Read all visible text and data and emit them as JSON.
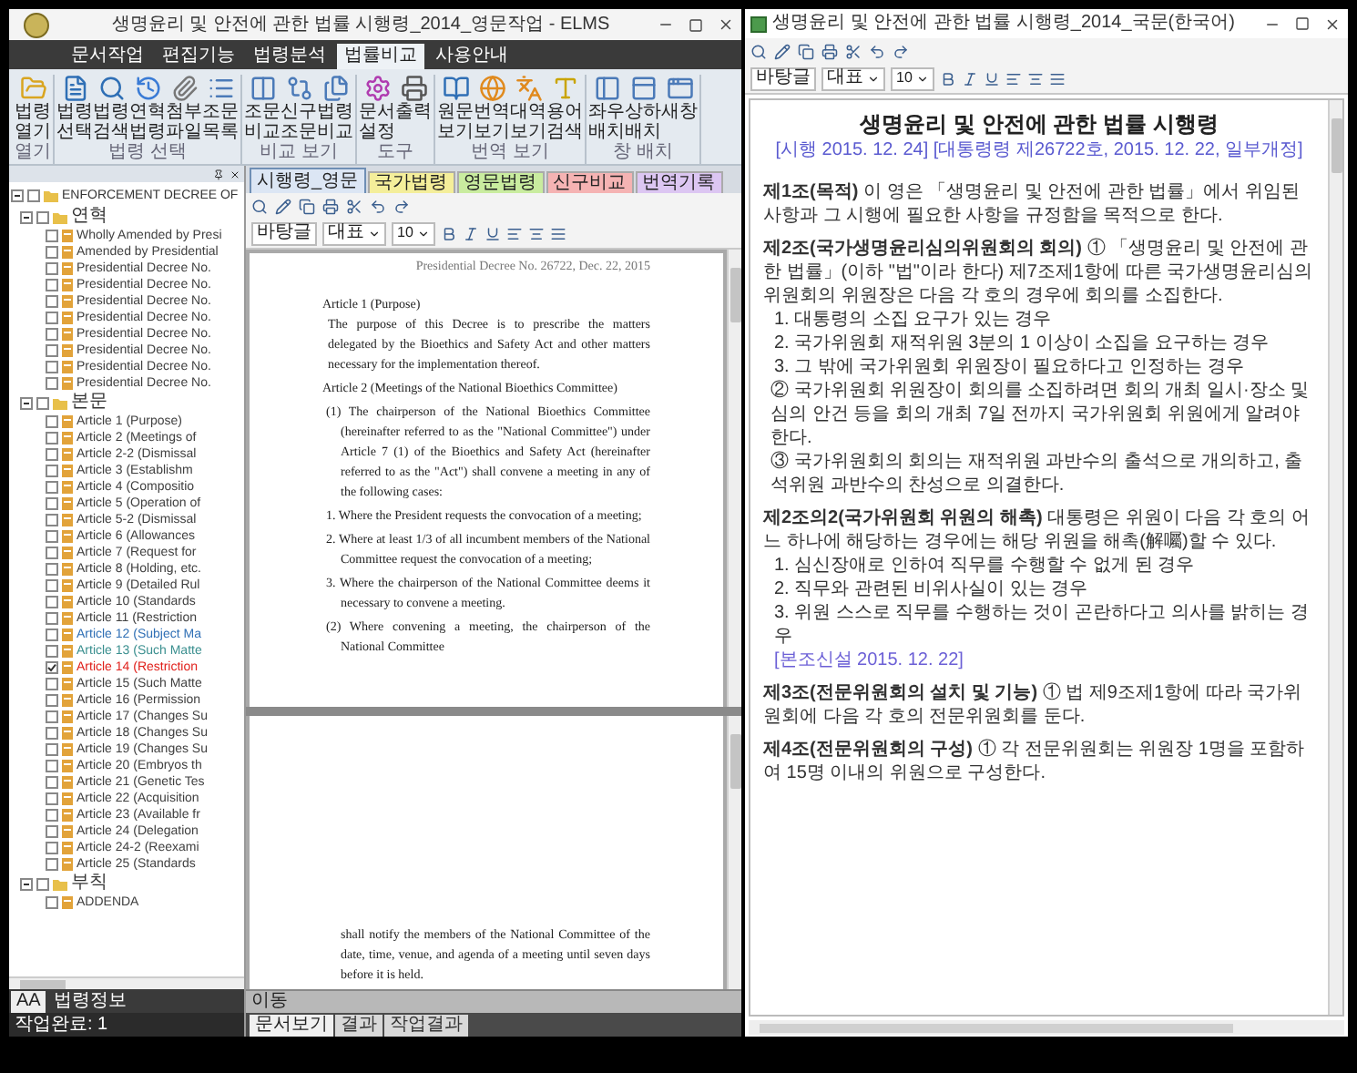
{
  "left_window": {
    "title": "생명윤리 및 안전에 관한 법률 시행령_2014_영문작업 - ELMS",
    "tabs": [
      {
        "label": "문서작업",
        "selected": false
      },
      {
        "label": "편집기능",
        "selected": false
      },
      {
        "label": "법령분석",
        "selected": false
      },
      {
        "label": "법률비교",
        "selected": true
      },
      {
        "label": "사용안내",
        "selected": false
      }
    ],
    "ribbon_groups": [
      {
        "label": "열기",
        "buttons": [
          "법령열기"
        ]
      },
      {
        "label": "법령 선택",
        "buttons": [
          "법령선택",
          "법령검색",
          "연혁법령",
          "첨부파일",
          "조문목록"
        ]
      },
      {
        "label": "비교 보기",
        "buttons": [
          "조문비교",
          "신구조문",
          "법령비교"
        ]
      },
      {
        "label": "도구",
        "buttons": [
          "문서설정",
          "출력"
        ]
      },
      {
        "label": "번역 보기",
        "buttons": [
          "원문보기",
          "번역보기",
          "대역보기",
          "용어검색"
        ]
      },
      {
        "label": "창 배치",
        "buttons": [
          "좌우배치",
          "상하배치",
          "새창"
        ]
      }
    ],
    "tree": [
      {
        "label": "ENFORCEMENT DECREE OF",
        "checked": false,
        "expanded": true,
        "children": [
          {
            "label": "연혁",
            "checked": false,
            "expanded": true,
            "children": [
              {
                "label": "Wholly Amended by Presi",
                "checked": false,
                "color": "#404040"
              },
              {
                "label": "Amended by Presidential",
                "checked": false,
                "color": "#404040"
              },
              {
                "label": "Presidential Decree No.",
                "checked": false,
                "color": "#404040"
              },
              {
                "label": "Presidential Decree No.",
                "checked": false,
                "color": "#404040"
              },
              {
                "label": "Presidential Decree No.",
                "checked": false,
                "color": "#404040"
              },
              {
                "label": "Presidential Decree No.",
                "checked": false,
                "color": "#404040"
              },
              {
                "label": "Presidential Decree No.",
                "checked": false,
                "color": "#404040"
              },
              {
                "label": "Presidential Decree No.",
                "checked": false,
                "color": "#404040"
              },
              {
                "label": "Presidential Decree No.",
                "checked": false,
                "color": "#404040"
              },
              {
                "label": "Presidential Decree No.",
                "checked": false,
                "color": "#404040"
              }
            ]
          },
          {
            "label": "본문",
            "checked": false,
            "expanded": true,
            "children": [
              {
                "label": "Article 1 (Purpose)",
                "checked": false,
                "color": "#404040"
              },
              {
                "label": "Article 2 (Meetings of",
                "checked": false,
                "color": "#404040"
              },
              {
                "label": "Article 2-2 (Dismissal",
                "checked": false,
                "color": "#404040"
              },
              {
                "label": "Article 3 (Establishm",
                "checked": false,
                "color": "#404040"
              },
              {
                "label": "Article 4 (Compositio",
                "checked": false,
                "color": "#404040"
              },
              {
                "label": "Article 5 (Operation of",
                "checked": false,
                "color": "#404040"
              },
              {
                "label": "Article 5-2 (Dismissal",
                "checked": false,
                "color": "#404040"
              },
              {
                "label": "Article 6 (Allowances",
                "checked": false,
                "color": "#404040"
              },
              {
                "label": "Article 7 (Request for",
                "checked": false,
                "color": "#404040"
              },
              {
                "label": "Article 8 (Holding, etc.",
                "checked": false,
                "color": "#404040"
              },
              {
                "label": "Article 9 (Detailed Rul",
                "checked": false,
                "color": "#404040"
              },
              {
                "label": "Article 10 (Standards",
                "checked": false,
                "color": "#404040"
              },
              {
                "label": "Article 11 (Restriction",
                "checked": false,
                "color": "#404040"
              },
              {
                "label": "Article 12 (Subject Ma",
                "checked": false,
                "color": "#2f6fb5"
              },
              {
                "label": "Article 13 (Such Matte",
                "checked": false,
                "color": "#3a8f8f"
              },
              {
                "label": "Article 14 (Restriction",
                "checked": true,
                "color": "#e0201b"
              },
              {
                "label": "Article 15 (Such Matte",
                "checked": false,
                "color": "#404040"
              },
              {
                "label": "Article 16 (Permission",
                "checked": false,
                "color": "#404040"
              },
              {
                "label": "Article 17 (Changes Su",
                "checked": false,
                "color": "#404040"
              },
              {
                "label": "Article 18 (Changes Su",
                "checked": false,
                "color": "#404040"
              },
              {
                "label": "Article 19 (Changes Su",
                "checked": false,
                "color": "#404040"
              },
              {
                "label": "Article 20 (Embryos th",
                "checked": false,
                "color": "#404040"
              },
              {
                "label": "Article 21 (Genetic Tes",
                "checked": false,
                "color": "#404040"
              },
              {
                "label": "Article 22 (Acquisition",
                "checked": false,
                "color": "#404040"
              },
              {
                "label": "Article 23 (Available fr",
                "checked": false,
                "color": "#404040"
              },
              {
                "label": "Article 24 (Delegation",
                "checked": false,
                "color": "#404040"
              },
              {
                "label": "Article 24-2 (Reexami",
                "checked": false,
                "color": "#404040"
              },
              {
                "label": "Article 25 (Standards",
                "checked": false,
                "color": "#404040"
              }
            ]
          },
          {
            "label": "부칙",
            "checked": false,
            "expanded": true,
            "children": [
              {
                "label": "ADDENDA",
                "checked": false,
                "color": "#404040"
              }
            ]
          }
        ]
      }
    ],
    "bottom_tabs": [
      {
        "label": "AA",
        "selected": true
      },
      {
        "label": "법령정보",
        "selected": false
      }
    ],
    "status": "작업완료: 1",
    "document": {
      "tabs": [
        {
          "label": "시행령_영문",
          "color": "#dce6f4",
          "selected": true
        },
        {
          "label": "국가법령",
          "color": "#f4ee9a",
          "selected": false
        },
        {
          "label": "영문법령",
          "color": "#c9ec9f",
          "selected": false
        },
        {
          "label": "신구비교",
          "color": "#f5b3b3",
          "selected": false
        },
        {
          "label": "번역기록",
          "color": "#dcc6f2",
          "selected": false
        }
      ],
      "style_select": "바탕글",
      "font_select": "대표",
      "size_select": "10",
      "page_top": [
        {
          "kind": "header",
          "text": "Presidential Decree No. 26722, Dec. 22, 2015"
        },
        {
          "kind": "heading",
          "text": "Article 1 (Purpose)"
        },
        {
          "kind": "para",
          "text": "The purpose of this Decree is to prescribe the matters delegated by the Bioethics and Safety Act and other matters necessary for the implementation thereof."
        },
        {
          "kind": "heading",
          "text": "Article 2 (Meetings of the National Bioethics Committee)"
        },
        {
          "kind": "numbered",
          "text": "(1) The chairperson of the National Bioethics Committee (hereinafter referred to as the \"National Committee\") under Article 7 (1) of the Bioethics and Safety Act (hereinafter referred to as the \"Act\") shall convene a meeting in any of the following cases:"
        },
        {
          "kind": "numbered",
          "text": "1. Where the President requests the convocation of a meeting;"
        },
        {
          "kind": "numbered",
          "text": "2. Where at least 1/3 of all incumbent members of the National Committee request the convocation of a meeting;"
        },
        {
          "kind": "numbered",
          "text": "3. Where the chairperson of the National Committee deems it necessary to convene a meeting."
        },
        {
          "kind": "numbered",
          "text": "(2) Where convening a meeting, the chairperson of the National Committee"
        }
      ],
      "page_bottom": "shall notify the members of the National Committee of the date, time, venue, and agenda of a meeting until seven days before it is held.",
      "pane_label": "이동",
      "pane_tabs": [
        {
          "label": "문서보기",
          "selected": true
        },
        {
          "label": "결과",
          "selected": false
        },
        {
          "label": "작업결과",
          "selected": false
        }
      ]
    }
  },
  "right_window": {
    "title": "생명윤리 및 안전에 관한 법률 시행령_2014_국문(한국어)",
    "style_select": "바탕글",
    "font_select": "대표",
    "size_select": "10",
    "doc_title": "생명윤리 및 안전에 관한 법률 시행령",
    "doc_subtitle": "[시행 2015. 12. 24] [대통령령 제26722호, 2015. 12. 22, 일부개정]",
    "paragraphs": [
      {
        "kind": "article",
        "text": "**제1조(목적)** 이 영은 「생명윤리 및 안전에 관한 법률」에서 위임된 사항과 그 시행에 필요한 사항을 규정함을 목적으로 한다."
      },
      {
        "kind": "article",
        "text": "**제2조(국가생명윤리심의위원회의 회의)** ① 「생명윤리 및 안전에 관한 법률」(이하 \"법\"이라 한다) 제7조제1항에 따른 국가생명윤리심의위원회의 위원장은 다음 각 호의 경우에 회의를 소집한다."
      },
      {
        "kind": "item",
        "text": "1. 대통령의 소집 요구가 있는 경우"
      },
      {
        "kind": "item",
        "text": "2. 국가위원회 재적위원 3분의 1 이상이 소집을 요구하는 경우"
      },
      {
        "kind": "item",
        "text": "3. 그 밖에 국가위원회 위원장이 필요하다고 인정하는 경우"
      },
      {
        "kind": "clause",
        "text": "② 국가위원회 위원장이 회의를 소집하려면 회의 개최 일시·장소 및 심의 안건 등을 회의 개최 7일 전까지 국가위원회 위원에게 알려야 한다."
      },
      {
        "kind": "clause",
        "text": "③ 국가위원회의 회의는 재적위원 과반수의 출석으로 개의하고, 출석위원 과반수의 찬성으로 의결한다."
      },
      {
        "kind": "article",
        "text": "**제2조의2(국가위원회 위원의 해촉)** 대통령은 위원이 다음 각 호의 어느 하나에 해당하는 경우에는 해당 위원을 해촉(解囑)할 수 있다."
      },
      {
        "kind": "item",
        "text": "1. 심신장애로 인하여 직무를 수행할 수 없게 된 경우"
      },
      {
        "kind": "item",
        "text": "2. 직무와 관련된 비위사실이 있는 경우"
      },
      {
        "kind": "item",
        "text": "3. 위원 스스로 직무를 수행하는 것이 곤란하다고 의사를 밝히는 경우"
      },
      {
        "kind": "note",
        "text": "[본조신설 2015. 12. 22]"
      },
      {
        "kind": "article",
        "text": "**제3조(전문위원회의 설치 및 기능)** ① 법 제9조제1항에 따라 국가위원회에 다음 각 호의 전문위원회를 둔다."
      },
      {
        "kind": "article",
        "text": "**제4조(전문위원회의 구성)** ① 각 전문위원회는 위원장 1명을 포함하여 15명 이내의 위원으로 구성한다."
      }
    ]
  }
}
